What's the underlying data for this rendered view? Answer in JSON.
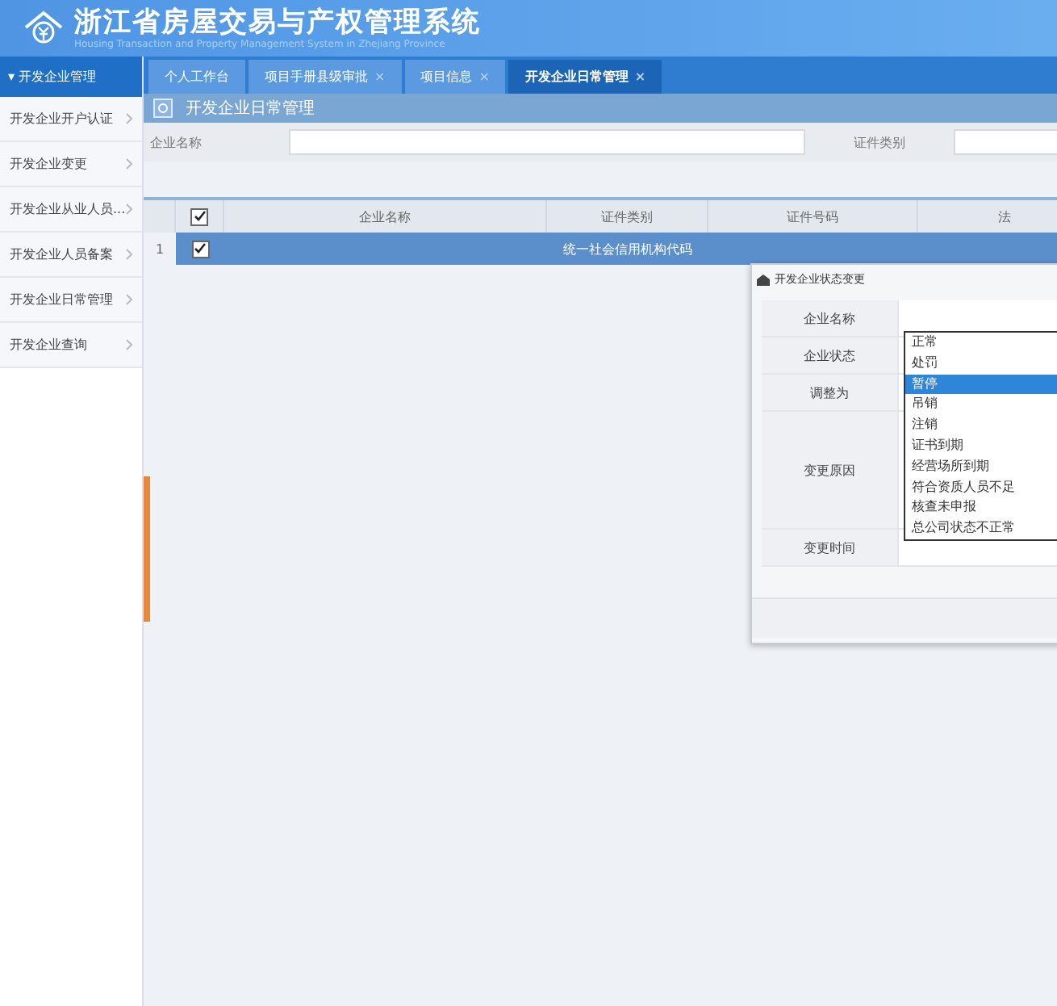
{
  "header": {
    "title": "浙江省房屋交易与产权管理系统",
    "subtitle": "Housing Transaction and Property Management System in Zhejiang Province"
  },
  "sidebar": {
    "title": "▾ 开发企业管理",
    "items": [
      {
        "label": "开发企业开户认证",
        "selected": false
      },
      {
        "label": "开发企业变更",
        "selected": false
      },
      {
        "label": "开发企业从业人员...",
        "selected": false
      },
      {
        "label": "开发企业人员备案",
        "selected": false
      },
      {
        "label": "开发企业日常管理",
        "selected": false
      },
      {
        "label": "开发企业查询",
        "selected": false
      }
    ]
  },
  "tabs": [
    {
      "label": "个人工作台",
      "selected": false
    },
    {
      "label": "项目手册县级审批",
      "close": "×",
      "selected": false
    },
    {
      "label": "项目信息",
      "close": "×",
      "selected": false
    },
    {
      "label": "开发企业日常管理",
      "close": "×",
      "selected": true
    }
  ],
  "page_title": "开发企业日常管理",
  "search": [
    {
      "label": "企业名称"
    },
    {
      "label": "证件类别"
    }
  ],
  "table": {
    "header_checked": true,
    "columns": [
      "企业名称",
      "证件类别",
      "证件号码",
      "法"
    ],
    "rows": [
      {
        "index": "1",
        "checked": true,
        "selected": true,
        "cells": [
          "",
          "统一社会信用机构代码",
          "",
          ""
        ]
      }
    ]
  },
  "dialog": {
    "title": "开发企业状态变更",
    "fields": [
      {
        "label": "企业名称",
        "kind": "text"
      },
      {
        "label": "企业状态",
        "kind": "text"
      },
      {
        "label": "调整为",
        "kind": "text"
      },
      {
        "label": "变更原因",
        "kind": "area"
      },
      {
        "label": "变更时间",
        "kind": "text"
      }
    ],
    "dropdown": [
      {
        "label": "正常",
        "selected": false
      },
      {
        "label": "处罚",
        "selected": false
      },
      {
        "label": "暂停",
        "selected": true
      },
      {
        "label": "吊销",
        "selected": false
      },
      {
        "label": "注销",
        "selected": false
      },
      {
        "label": "证书到期",
        "selected": false
      },
      {
        "label": "经营场所到期",
        "selected": false
      },
      {
        "label": "符合资质人员不足",
        "selected": false
      },
      {
        "label": "核查未申报",
        "selected": false
      },
      {
        "label": "总公司状态不正常",
        "selected": false
      }
    ]
  }
}
